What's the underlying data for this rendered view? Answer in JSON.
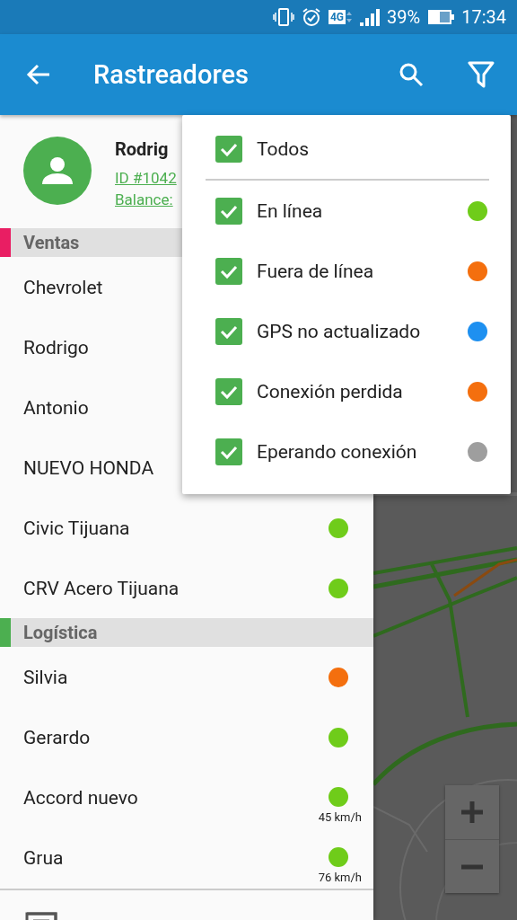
{
  "status_bar": {
    "signal_label": "4G",
    "battery": "39%",
    "time": "17:34"
  },
  "app_bar": {
    "title": "Rastreadores"
  },
  "profile": {
    "name": "Rodrig",
    "id": "ID #1042",
    "balance": "Balance:"
  },
  "groups": [
    {
      "name": "Ventas",
      "color": "#e91e63",
      "trackers": [
        {
          "name": "Chevrolet"
        },
        {
          "name": "Rodrigo"
        },
        {
          "name": "Antonio"
        },
        {
          "name": "NUEVO HONDA"
        },
        {
          "name": "Civic Tijuana",
          "color": "#6fcc1a"
        },
        {
          "name": "CRV Acero Tijuana",
          "color": "#6fcc1a"
        }
      ]
    },
    {
      "name": "Logística",
      "color": "#4caf50",
      "trackers": [
        {
          "name": "Silvia",
          "color": "#f46f0e"
        },
        {
          "name": "Gerardo",
          "color": "#6fcc1a"
        },
        {
          "name": "Accord nuevo",
          "color": "#6fcc1a",
          "speed": "45 km/h"
        },
        {
          "name": "Grua",
          "color": "#6fcc1a",
          "speed": "76 km/h"
        }
      ]
    }
  ],
  "filter_menu": {
    "all": {
      "label": "Todos",
      "checked": true
    },
    "items": [
      {
        "label": "En línea",
        "checked": true,
        "color": "#6fcc1a"
      },
      {
        "label": "Fuera de línea",
        "checked": true,
        "color": "#f46f0e"
      },
      {
        "label": "GPS no actualizado",
        "checked": true,
        "color": "#1e90f0"
      },
      {
        "label": "Conexión perdida",
        "checked": true,
        "color": "#f46f0e"
      },
      {
        "label": "Eperando conexión",
        "checked": true,
        "color": "#9e9e9e"
      }
    ]
  }
}
